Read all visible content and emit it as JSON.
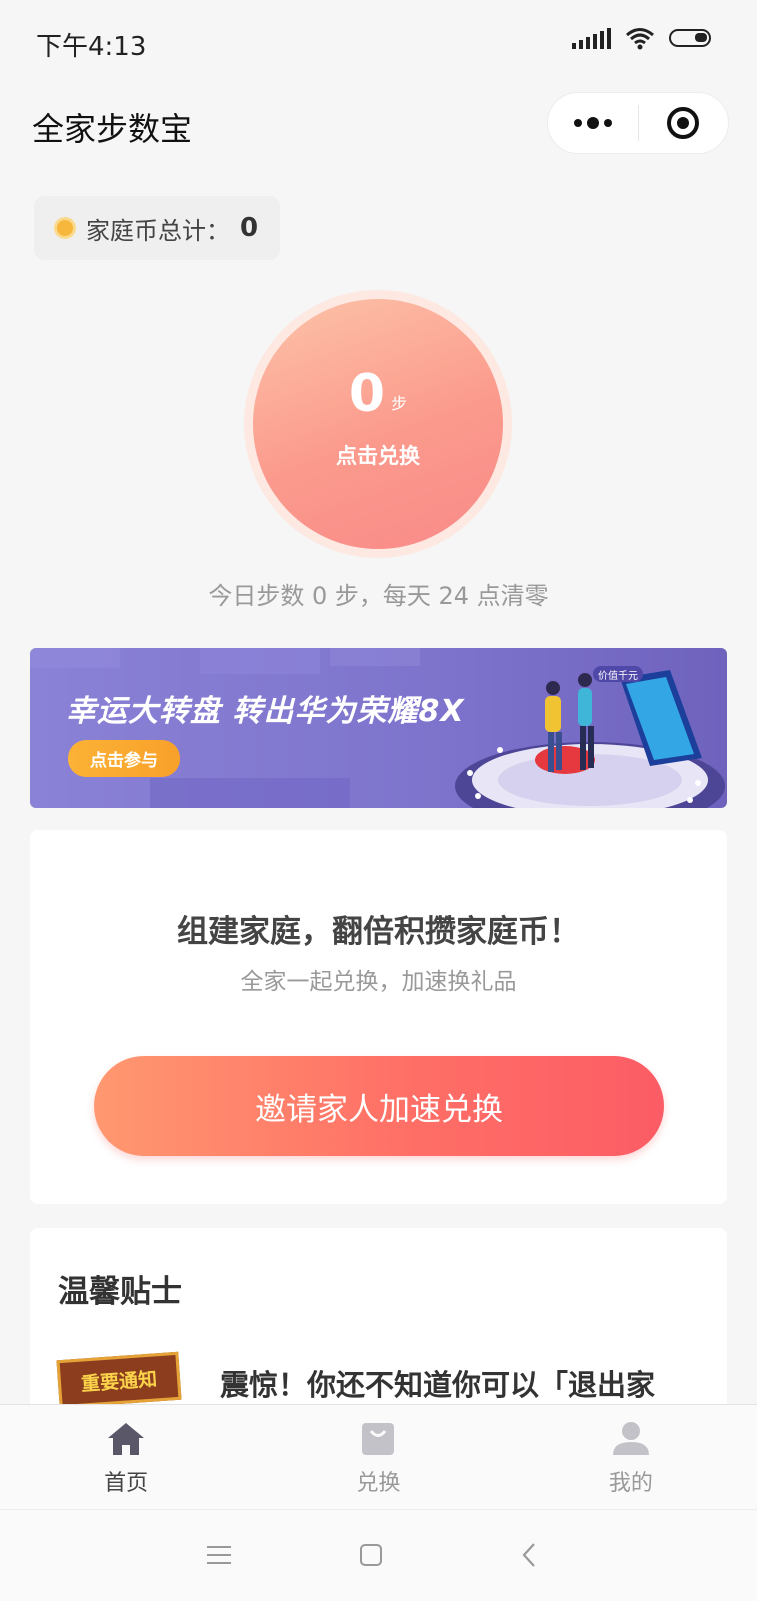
{
  "status_bar": {
    "time": "下午4:13"
  },
  "app": {
    "title": "全家步数宝"
  },
  "family_coins": {
    "label": "家庭币总计：",
    "value": "0"
  },
  "steps": {
    "count": "0",
    "unit": "步",
    "action_label": "点击兑换"
  },
  "today_info": "今日步数 0 步，每天 24 点清零",
  "banner": {
    "title": "幸运大转盘  转出华为荣耀8X",
    "button_label": "点击参与",
    "price_tag": "价值千元"
  },
  "invite": {
    "title": "组建家庭，翻倍积攒家庭币！",
    "subtitle": "全家一起兑换，加速换礼品",
    "button_label": "邀请家人加速兑换"
  },
  "tips": {
    "title": "温馨贴士",
    "notice_badge": "重要通知",
    "notice_text": "震惊！你还不知道你可以「退出家"
  },
  "tab_bar": {
    "items": [
      {
        "label": "首页",
        "icon": "home-icon",
        "active": true
      },
      {
        "label": "兑换",
        "icon": "bag-icon",
        "active": false
      },
      {
        "label": "我的",
        "icon": "user-icon",
        "active": false
      }
    ]
  },
  "colors": {
    "accent": "#fc6a66",
    "coin": "#f6b73c",
    "banner": "#7d73cc",
    "tab_active": "#5a5768",
    "tab_inactive": "#c2c2c8"
  }
}
